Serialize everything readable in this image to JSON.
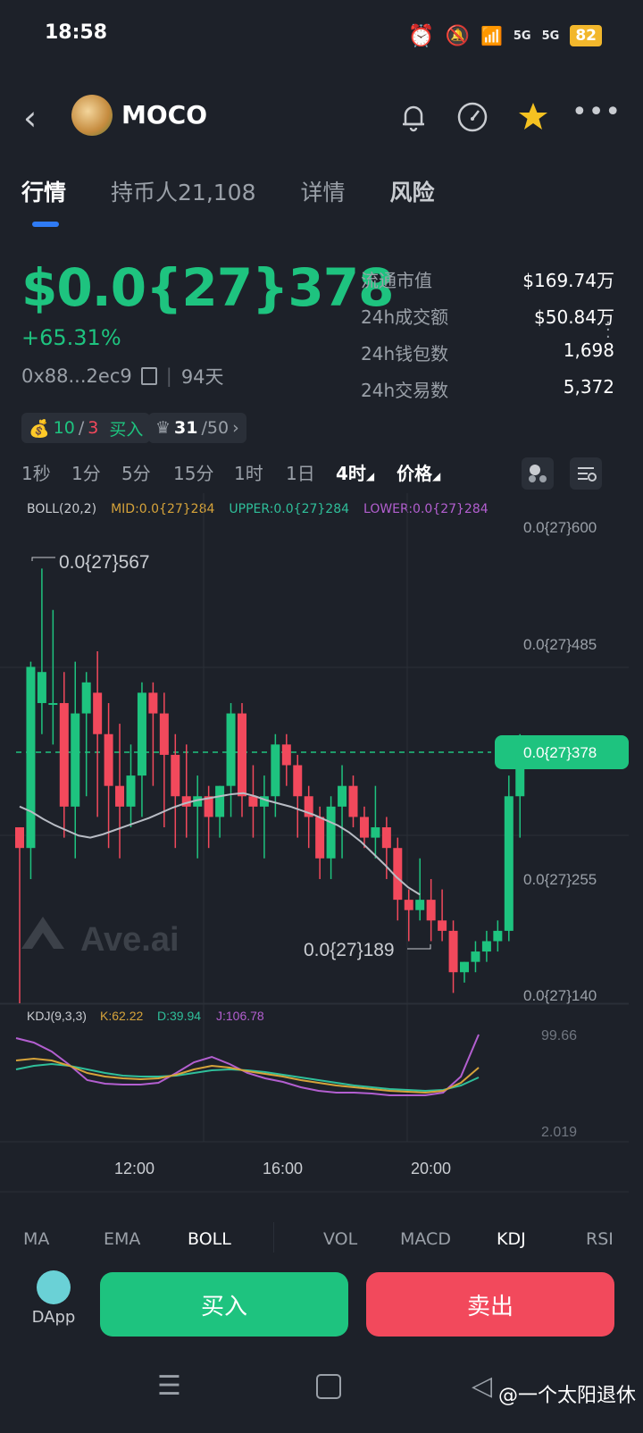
{
  "status_bar": {
    "time": "18:58",
    "battery": "82",
    "net1": "5G",
    "net2": "5G"
  },
  "header": {
    "coin": "MOCO"
  },
  "tabs": [
    {
      "label": "行情"
    },
    {
      "label": "持币人21,108"
    },
    {
      "label": "详情"
    },
    {
      "label": "风险"
    }
  ],
  "price": {
    "value": "$0.0{27}378",
    "change": "+65.31%",
    "address": "0x88...2ec9",
    "age": "94天"
  },
  "stats": [
    {
      "k": "流通市值",
      "v": "$169.74万"
    },
    {
      "k": "24h成交额",
      "v": "$50.84万"
    },
    {
      "k": "24h钱包数",
      "v": "1,698"
    },
    {
      "k": "24h交易数",
      "v": "5,372"
    }
  ],
  "badges": {
    "buy_green": "10",
    "slash": "/",
    "buy_red": "3",
    "buy_label": "买入",
    "crown_a": "31",
    "crown_b": "/50"
  },
  "intervals": [
    "1秒",
    "1分",
    "5分",
    "15分",
    "1时",
    "1日",
    "4时",
    "价格"
  ],
  "legend": {
    "boll": "BOLL(20,2)",
    "mid": "MID:0.0{27}284",
    "upper": "UPPER:0.0{27}284",
    "lower": "LOWER:0.0{27}284",
    "kdj": "KDJ(9,3,3)",
    "k": "K:62.22",
    "d": "D:39.94",
    "j": "J:106.78"
  },
  "chart_labels": {
    "y1": "0.0{27}600",
    "y2": "0.0{27}485",
    "y3": "0.0{27}378",
    "y4": "0.0{27}255",
    "y5": "0.0{27}140",
    "high": "0.0{27}567",
    "low": "0.0{27}189",
    "kdj_hi": "99.66",
    "kdj_lo": "2.019",
    "x1": "12:00",
    "x2": "16:00",
    "x3": "20:00",
    "watermark": "Ave.ai"
  },
  "indicator_tabs": [
    "MA",
    "EMA",
    "BOLL",
    "VOL",
    "MACD",
    "KDJ",
    "RSI"
  ],
  "actions": {
    "dapp": "DApp",
    "buy": "买入",
    "sell": "卖出"
  },
  "footer": {
    "watermark": "@一个太阳退休"
  },
  "colors": {
    "up": "#1ec37f",
    "down": "#f2495c",
    "bg": "#1d2129"
  },
  "chart_data": {
    "type": "candlestick",
    "candles": [
      [
        310,
        310,
        140,
        290
      ],
      [
        290,
        470,
        260,
        465
      ],
      [
        430,
        560,
        400,
        460
      ],
      [
        430,
        520,
        390,
        430
      ],
      [
        430,
        460,
        300,
        330
      ],
      [
        330,
        470,
        280,
        420
      ],
      [
        420,
        460,
        340,
        450
      ],
      [
        440,
        480,
        320,
        400
      ],
      [
        400,
        430,
        290,
        350
      ],
      [
        350,
        410,
        280,
        330
      ],
      [
        330,
        390,
        310,
        360
      ],
      [
        360,
        450,
        320,
        440
      ],
      [
        440,
        450,
        350,
        420
      ],
      [
        420,
        440,
        310,
        380
      ],
      [
        380,
        400,
        290,
        340
      ],
      [
        340,
        390,
        300,
        330
      ],
      [
        330,
        360,
        280,
        340
      ],
      [
        340,
        350,
        290,
        320
      ],
      [
        320,
        350,
        300,
        350
      ],
      [
        350,
        430,
        320,
        420
      ],
      [
        420,
        430,
        320,
        340
      ],
      [
        340,
        370,
        300,
        330
      ],
      [
        330,
        360,
        280,
        340
      ],
      [
        340,
        400,
        320,
        390
      ],
      [
        390,
        400,
        350,
        370
      ],
      [
        370,
        380,
        300,
        340
      ],
      [
        340,
        350,
        290,
        320
      ],
      [
        320,
        330,
        260,
        280
      ],
      [
        280,
        340,
        260,
        330
      ],
      [
        330,
        370,
        280,
        350
      ],
      [
        350,
        360,
        310,
        320
      ],
      [
        320,
        330,
        290,
        300
      ],
      [
        300,
        350,
        280,
        310
      ],
      [
        310,
        320,
        260,
        290
      ],
      [
        290,
        300,
        220,
        240
      ],
      [
        240,
        250,
        200,
        230
      ],
      [
        230,
        280,
        220,
        240
      ],
      [
        240,
        260,
        200,
        220
      ],
      [
        220,
        250,
        200,
        210
      ],
      [
        210,
        220,
        150,
        170
      ],
      [
        170,
        180,
        160,
        180
      ],
      [
        180,
        200,
        170,
        190
      ],
      [
        190,
        210,
        180,
        200
      ],
      [
        200,
        220,
        190,
        210
      ],
      [
        210,
        360,
        200,
        340
      ],
      [
        340,
        400,
        300,
        380
      ]
    ],
    "boll_mid": [
      330,
      325,
      318,
      312,
      307,
      302,
      300,
      303,
      307,
      311,
      315,
      319,
      324,
      329,
      333,
      336,
      338,
      340,
      342,
      343,
      340,
      336,
      333,
      330,
      326,
      322,
      317,
      312,
      305,
      296,
      285,
      274,
      262,
      252,
      245
    ],
    "kdj_k": [
      70,
      72,
      70,
      64,
      56,
      52,
      50,
      49,
      50,
      54,
      60,
      64,
      62,
      58,
      55,
      52,
      48,
      45,
      42,
      40,
      38,
      36,
      35,
      34,
      36,
      45,
      62
    ],
    "kdj_d": [
      60,
      64,
      66,
      64,
      60,
      56,
      53,
      52,
      52,
      53,
      56,
      59,
      60,
      59,
      57,
      54,
      51,
      48,
      45,
      42,
      40,
      38,
      37,
      36,
      37,
      42,
      51
    ],
    "kdj_j": [
      95,
      90,
      80,
      65,
      48,
      44,
      43,
      43,
      45,
      56,
      68,
      74,
      66,
      56,
      50,
      46,
      40,
      36,
      34,
      34,
      33,
      31,
      31,
      31,
      34,
      52,
      99
    ]
  }
}
